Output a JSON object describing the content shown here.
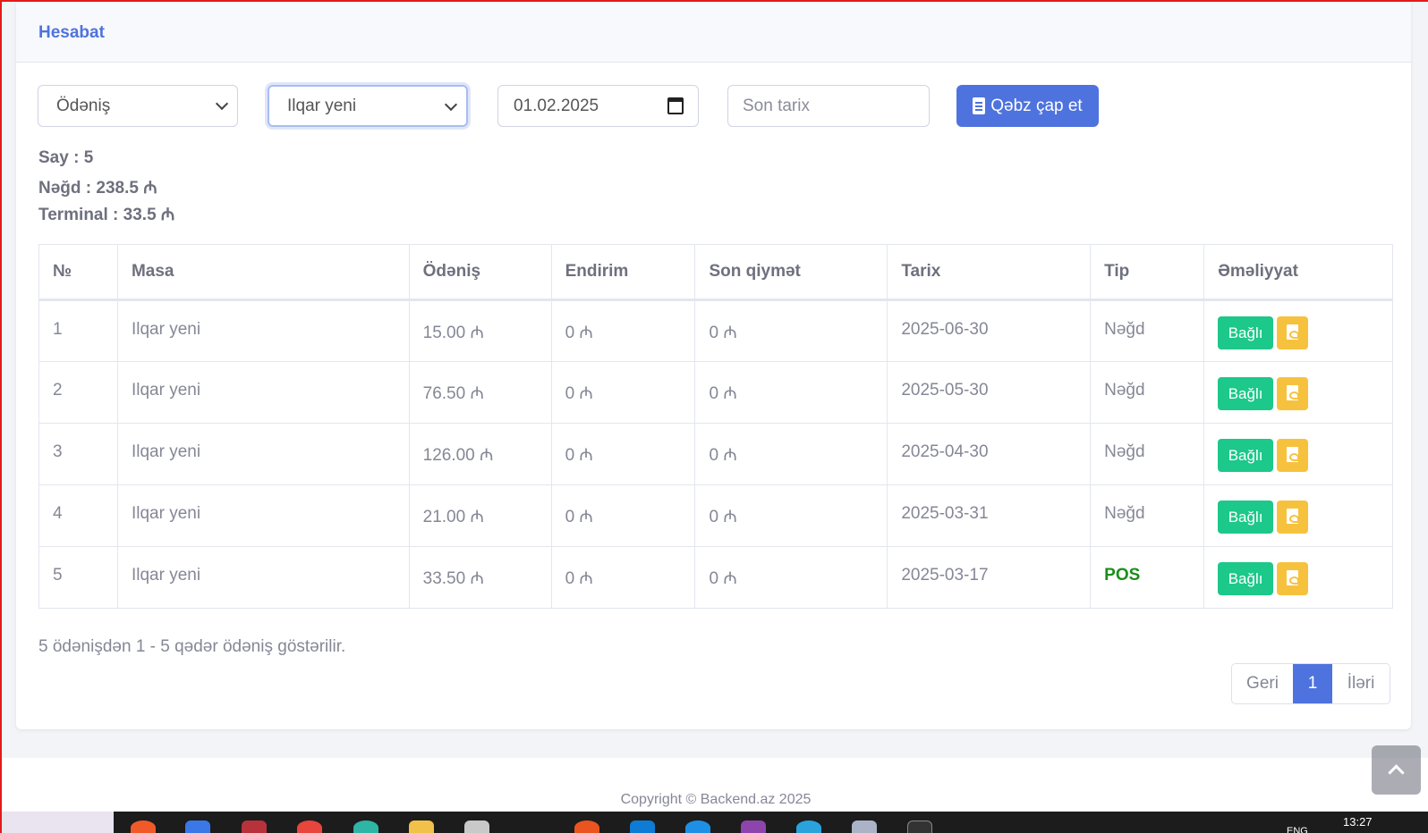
{
  "header": {
    "title": "Hesabat"
  },
  "filters": {
    "payment_select": "Ödəniş",
    "user_select": "Ilqar yeni",
    "start_date": "01.02.2025",
    "end_date_placeholder": "Son tarix",
    "print_button": "Qəbz çap et"
  },
  "summary": {
    "count": "Say : 5",
    "cash": "Nəğd : 238.5 ₼",
    "terminal": "Terminal : 33.5 ₼"
  },
  "table": {
    "columns": [
      "№",
      "Masa",
      "Ödəniş",
      "Endirim",
      "Son qiymət",
      "Tarix",
      "Tip",
      "Əməliyyat"
    ],
    "rows": [
      {
        "no": "1",
        "masa": "Ilqar yeni",
        "payment": "15.00 ₼",
        "discount": "0 ₼",
        "final": "0 ₼",
        "date": "2025-06-30",
        "type": "Nəğd",
        "action": "Bağlı"
      },
      {
        "no": "2",
        "masa": "Ilqar yeni",
        "payment": "76.50 ₼",
        "discount": "0 ₼",
        "final": "0 ₼",
        "date": "2025-05-30",
        "type": "Nəğd",
        "action": "Bağlı"
      },
      {
        "no": "3",
        "masa": "Ilqar yeni",
        "payment": "126.00 ₼",
        "discount": "0 ₼",
        "final": "0 ₼",
        "date": "2025-04-30",
        "type": "Nəğd",
        "action": "Bağlı"
      },
      {
        "no": "4",
        "masa": "Ilqar yeni",
        "payment": "21.00 ₼",
        "discount": "0 ₼",
        "final": "0 ₼",
        "date": "2025-03-31",
        "type": "Nəğd",
        "action": "Bağlı"
      },
      {
        "no": "5",
        "masa": "Ilqar yeni",
        "payment": "33.50 ₼",
        "discount": "0 ₼",
        "final": "0 ₼",
        "date": "2025-03-17",
        "type": "POS",
        "action": "Bağlı"
      }
    ]
  },
  "pagination": {
    "info": "5 ödənişdən 1 - 5 qədər ödəniş göstərilir.",
    "prev": "Geri",
    "current": "1",
    "next": "İləri"
  },
  "footer": {
    "copyright": "Copyright © Backend.az 2025"
  },
  "taskbar": {
    "time": "13:27",
    "lang": "ENG"
  },
  "colors": {
    "primary": "#4e73df",
    "success": "#1cc88a",
    "warning": "#f6c23e",
    "pos_text": "#1a8f1a"
  }
}
